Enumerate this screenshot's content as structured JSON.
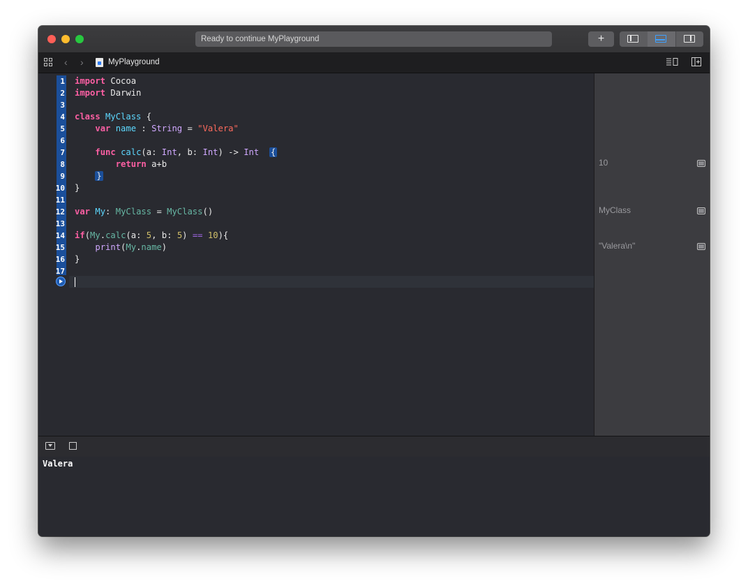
{
  "window": {
    "activity_text": "Ready to continue MyPlayground",
    "add_button": "+"
  },
  "jumpbar": {
    "file_name": "MyPlayground",
    "back": "‹",
    "forward": "›"
  },
  "editor": {
    "line_numbers": [
      "1",
      "2",
      "3",
      "4",
      "5",
      "6",
      "7",
      "8",
      "9",
      "10",
      "11",
      "12",
      "13",
      "14",
      "15",
      "16",
      "17"
    ]
  },
  "results": {
    "items": [
      {
        "text": "10",
        "line": 8
      },
      {
        "text": "MyClass",
        "line": 12
      },
      {
        "text": "\"Valera\\n\"",
        "line": 15
      }
    ]
  },
  "console": {
    "output": "Valera"
  },
  "colors": {
    "keyword": "#fc5fa3",
    "type": "#5dd8ff",
    "string": "#fc6a5d",
    "number": "#d0bf69",
    "selection": "#1b4f9a"
  }
}
